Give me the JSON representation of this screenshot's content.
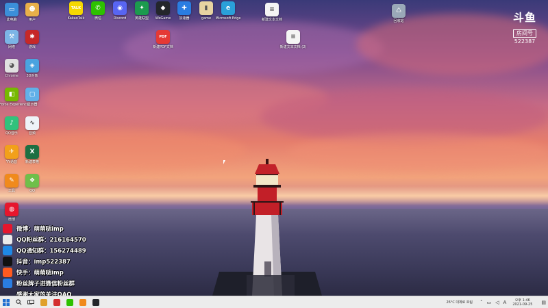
{
  "desktop": {
    "icons": [
      {
        "id": "pc",
        "label": "此电脑",
        "color": "#3b8fd9",
        "glyph": "▭"
      },
      {
        "id": "user",
        "label": "用户",
        "color": "#e8b04a",
        "glyph": "☻"
      },
      {
        "id": "talk",
        "label": "KakaoTalk",
        "color": "#f5d800",
        "glyph": "TALK"
      },
      {
        "id": "wechat",
        "label": "微信",
        "color": "#2dc100",
        "glyph": "✆"
      },
      {
        "id": "discord",
        "label": "Discord",
        "color": "#5865f2",
        "glyph": "◉"
      },
      {
        "id": "lol",
        "label": "英雄联盟",
        "color": "#1c9b4e",
        "glyph": "✦"
      },
      {
        "id": "wegame",
        "label": "WeGame",
        "color": "#23262b",
        "glyph": "◆"
      },
      {
        "id": "tool",
        "label": "加速器",
        "color": "#2a7de1",
        "glyph": "✚"
      },
      {
        "id": "folder",
        "label": "game",
        "color": "#e6d3a1",
        "glyph": "▮"
      },
      {
        "id": "edge",
        "label": "Microsoft Edge",
        "color": "#2aa0d9",
        "glyph": "e"
      },
      {
        "id": "doc1",
        "label": "新建文本文档",
        "color": "#f4f4f4",
        "glyph": "≡"
      },
      {
        "id": "recycle",
        "label": "回收站",
        "color": "#9aa8b8",
        "glyph": "♺"
      },
      {
        "id": "net",
        "label": "网络",
        "color": "#7cb4e6",
        "glyph": "⚒"
      },
      {
        "id": "game2",
        "label": "游戏",
        "color": "#c62828",
        "glyph": "✱"
      },
      {
        "id": "pdf",
        "label": "新建PDF文档",
        "color": "#e53935",
        "glyph": "PDF"
      },
      {
        "id": "doc2",
        "label": "新建文本文档 (2)",
        "color": "#f4f4f4",
        "glyph": "≡"
      },
      {
        "id": "chrome",
        "label": "Chrome",
        "color": "#e0e0e0",
        "glyph": "◕"
      },
      {
        "id": "cube",
        "label": "3D对象",
        "color": "#4aa3e0",
        "glyph": "◈"
      },
      {
        "id": "nvidia",
        "label": "GeForce Experience",
        "color": "#76b900",
        "glyph": "◧"
      },
      {
        "id": "monitor",
        "label": "显示器",
        "color": "#61b0e8",
        "glyph": "▢"
      },
      {
        "id": "qq",
        "label": "QQ音乐",
        "color": "#31c27c",
        "glyph": "♪"
      },
      {
        "id": "wave",
        "label": "音频",
        "color": "#eef3f8",
        "glyph": "∿"
      },
      {
        "id": "bird",
        "label": "YY语音",
        "color": "#f2a01a",
        "glyph": "✈"
      },
      {
        "id": "excel",
        "label": "新建表格",
        "color": "#1d6f42",
        "glyph": "X"
      },
      {
        "id": "tools",
        "label": "工具",
        "color": "#f08a1c",
        "glyph": "✎"
      },
      {
        "id": "qqapp",
        "label": "QQ",
        "color": "#6fbf4a",
        "glyph": "❖"
      },
      {
        "id": "weibo",
        "label": "微博",
        "color": "#e6162d",
        "glyph": "◍"
      }
    ]
  },
  "watermark": {
    "logo": "斗鱼",
    "room_label": "房间号",
    "room_number": "522387"
  },
  "overlay": {
    "lines": [
      {
        "text": "微博：萌萌哒imp",
        "color": "#e6162d"
      },
      {
        "text": "QQ粉丝群：216164570",
        "color": "#ffffff"
      },
      {
        "text": "QQ通知群：156274489",
        "color": "#1e88e5"
      },
      {
        "text": "抖音：imp522387",
        "color": "#111111"
      },
      {
        "text": "快手：萌萌哒imp",
        "color": "#ff5a1f"
      },
      {
        "text": "粉丝牌子进微信粉丝群",
        "color": "#2a7de1"
      },
      {
        "text": "感谢大家的关注QAQ",
        "color": "#00000000"
      }
    ]
  },
  "taskbar": {
    "start_icon": "windows-start-icon",
    "search_icon": "search-icon",
    "taskview_icon": "task-view-icon",
    "apps": [
      {
        "name": "chrome",
        "color": "#e0a02a"
      },
      {
        "name": "app-red",
        "color": "#d32f2f"
      },
      {
        "name": "wechat",
        "color": "#2dc100"
      },
      {
        "name": "app-orange",
        "color": "#f08a1c"
      },
      {
        "name": "app-dark",
        "color": "#23262b"
      }
    ],
    "weather": "26°C 대체로 흐림",
    "tray_label": "A",
    "time": "오후 1:46",
    "date": "2021-09-25"
  }
}
